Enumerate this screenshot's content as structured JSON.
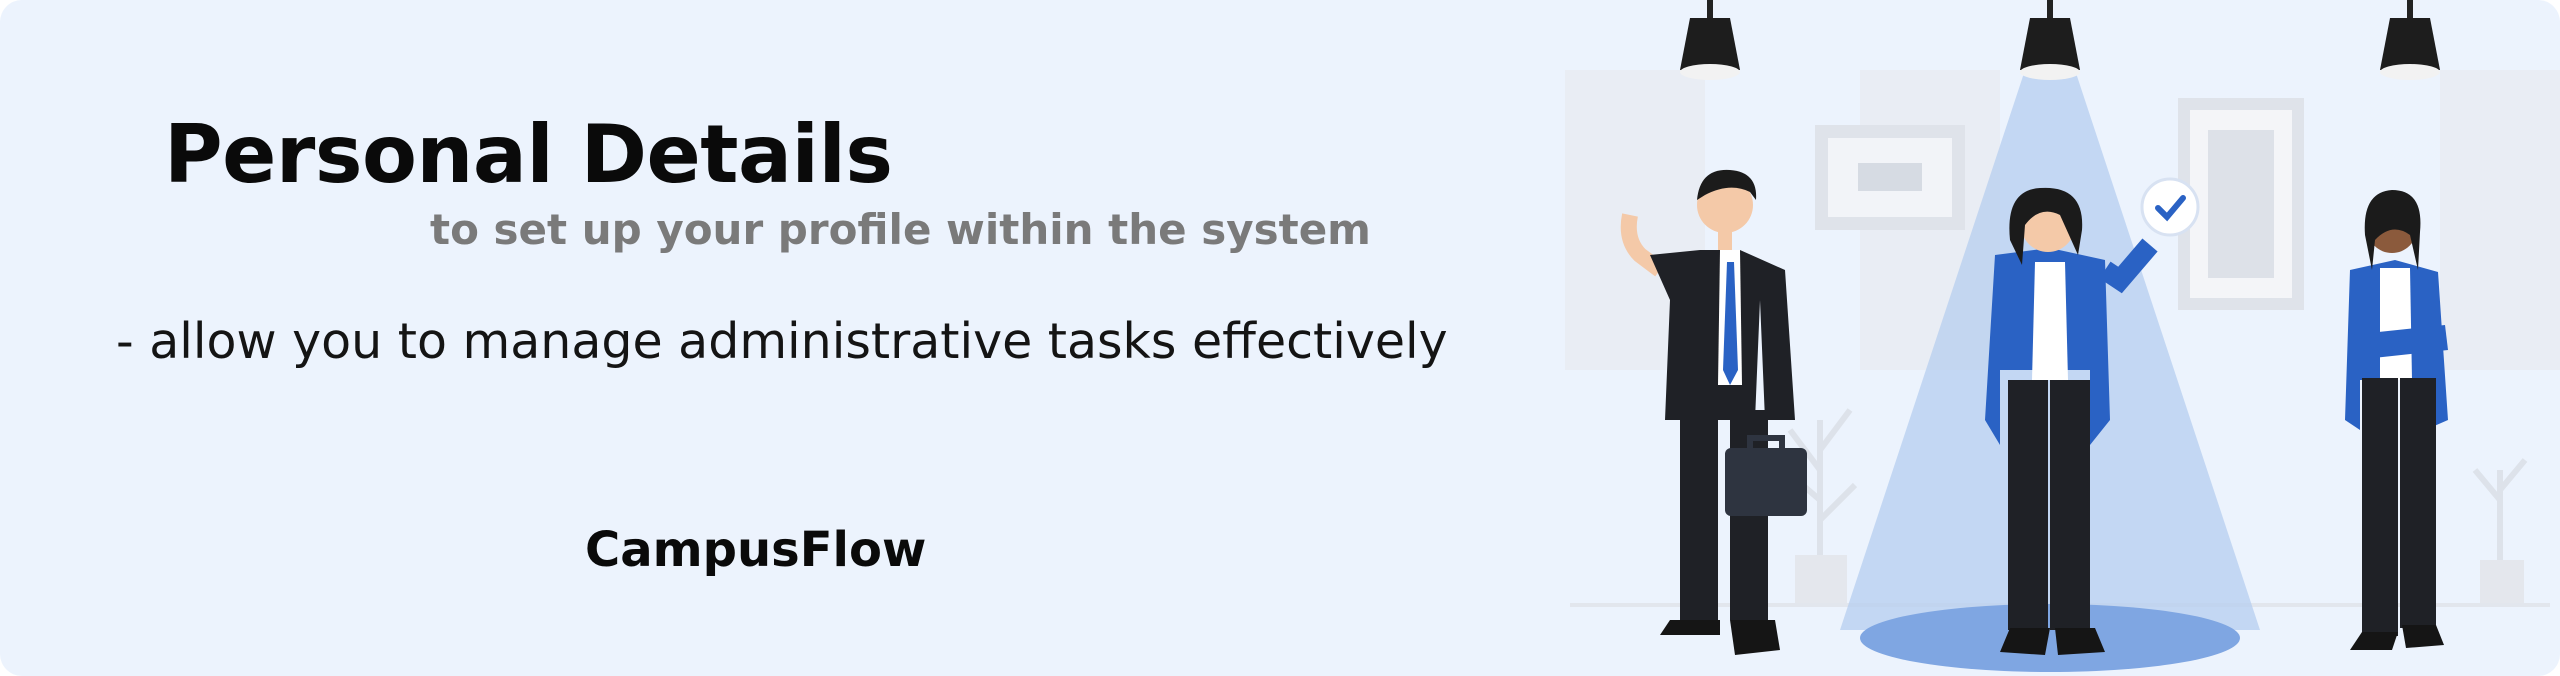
{
  "banner": {
    "title": "Personal Details",
    "subtitle": "to set up your profile within the system",
    "bullet": "- allow you to manage administrative tasks effectively",
    "brand": "CampusFlow"
  },
  "illustration": {
    "description_icon": "three-business-people-spotlight-illustration",
    "accent_color": "#2a62c4",
    "background_color": "#ecf3fd"
  }
}
